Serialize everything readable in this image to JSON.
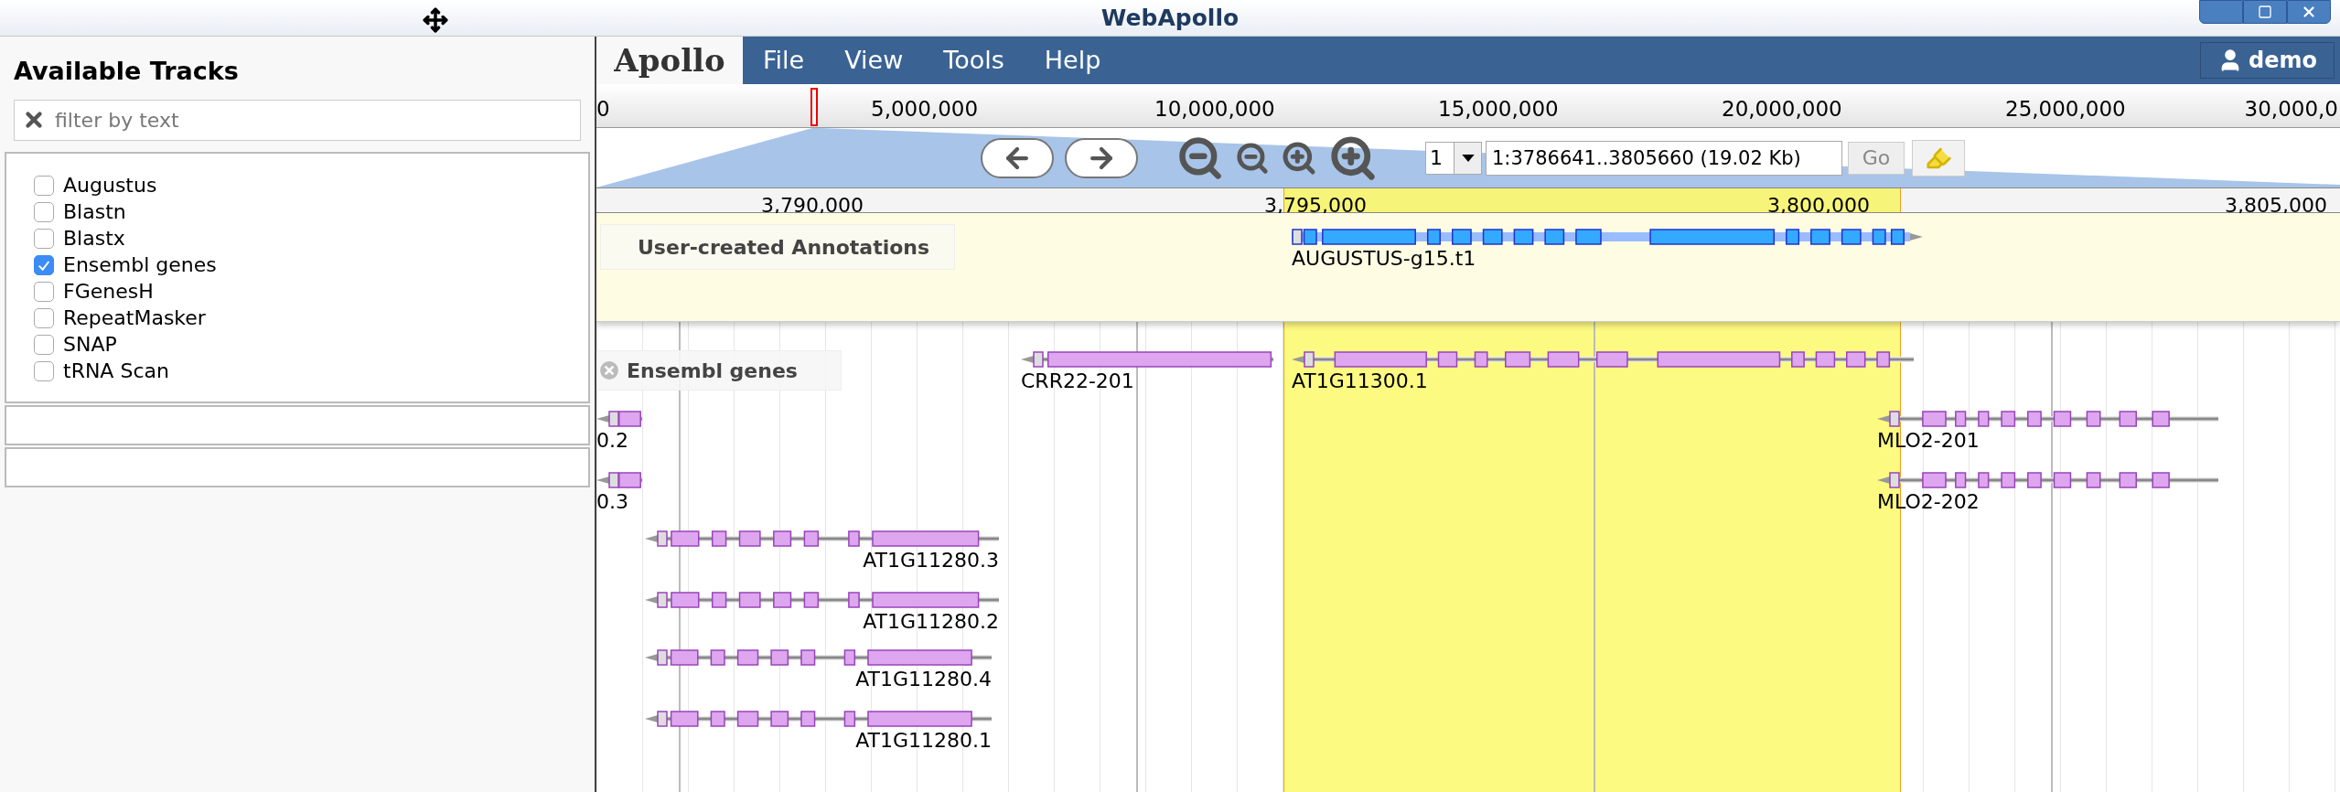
{
  "window": {
    "title": "WebApollo"
  },
  "sidebar": {
    "heading": "Available Tracks",
    "filter": {
      "placeholder": "filter by text"
    },
    "tracks": [
      {
        "label": "Augustus",
        "checked": false
      },
      {
        "label": "Blastn",
        "checked": false
      },
      {
        "label": "Blastx",
        "checked": false
      },
      {
        "label": "Ensembl genes",
        "checked": true
      },
      {
        "label": "FGenesH",
        "checked": false
      },
      {
        "label": "RepeatMasker",
        "checked": false
      },
      {
        "label": "SNAP",
        "checked": false
      },
      {
        "label": "tRNA Scan",
        "checked": false
      }
    ]
  },
  "menubar": {
    "logo": "Apollo",
    "menus": [
      "File",
      "View",
      "Tools",
      "Help"
    ],
    "user": "demo"
  },
  "overview_ruler": {
    "labels": [
      "0",
      "5,000,000",
      "10,000,000",
      "15,000,000",
      "20,000,000",
      "25,000,000",
      "30,000,0"
    ]
  },
  "navigation": {
    "refseq": "1",
    "location": "1:3786641..3805660 (19.02 Kb)",
    "go": "Go"
  },
  "detail_ruler": {
    "labels": [
      "3,790,000",
      "3,795,000",
      "3,800,000",
      "3,805,000"
    ]
  },
  "tracks": [
    {
      "kind": "annotation",
      "label": "User-created Annotations",
      "features": [
        {
          "label": "AUGUSTUS-g15.t1"
        }
      ]
    },
    {
      "kind": "evidence",
      "label": "Ensembl genes",
      "features": [
        {
          "label": "CRR22-201"
        },
        {
          "label": "AT1G11300.1"
        },
        {
          "label": "0.2"
        },
        {
          "label": "MLO2-201"
        },
        {
          "label": "0.3"
        },
        {
          "label": "MLO2-202"
        },
        {
          "label": "AT1G11280.3"
        },
        {
          "label": "AT1G11280.2"
        },
        {
          "label": "AT1G11280.4"
        },
        {
          "label": "AT1G11280.1"
        }
      ]
    }
  ]
}
